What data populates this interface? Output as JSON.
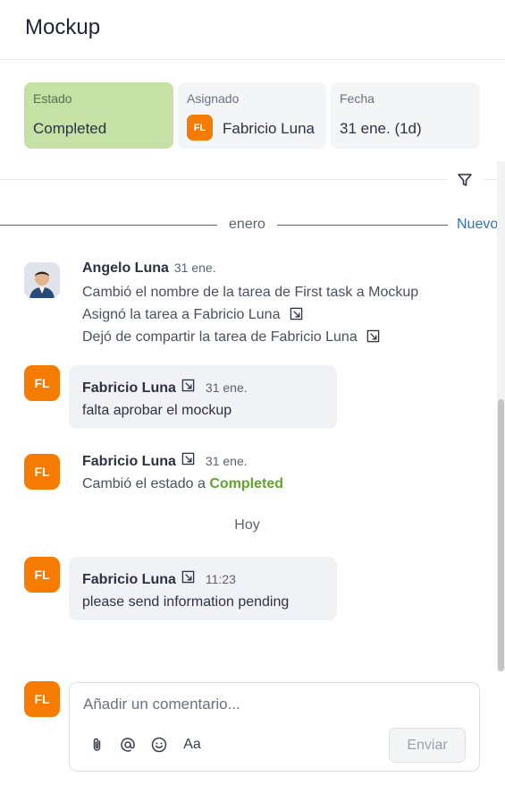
{
  "header": {
    "title": "Mockup"
  },
  "fields": {
    "status": {
      "label": "Estado",
      "value": "Completed"
    },
    "assignee": {
      "label": "Asignado",
      "initials": "FL",
      "value": "Fabricio Luna"
    },
    "date": {
      "label": "Fecha",
      "value": "31 ene. (1d)"
    }
  },
  "separator": {
    "month": "enero",
    "new_label": "Nuevo"
  },
  "feed": [
    {
      "author": "Angelo Luna",
      "time": "31 ene.",
      "lines": [
        "Cambió el nombre de la tarea de First task a Mockup",
        "Asignó la tarea a Fabricio Luna",
        "Dejó de compartir la tarea de Fabricio Luna"
      ]
    },
    {
      "author": "Fabricio Luna",
      "initials": "FL",
      "time": "31 ene.",
      "message": "falta aprobar el mockup"
    },
    {
      "author": "Fabricio Luna",
      "initials": "FL",
      "time": "31 ene.",
      "prefix": "Cambió el estado a",
      "status": "Completed"
    },
    {
      "author": "Fabricio Luna",
      "initials": "FL",
      "time": "11:23",
      "message": "please send information pending"
    }
  ],
  "day_label": "Hoy",
  "composer": {
    "initials": "FL",
    "placeholder": "Añadir un comentario...",
    "format_label": "Aa",
    "send_label": "Enviar"
  },
  "colors": {
    "status_completed_bg": "#c5e1a5",
    "status_completed_text": "#5fa52e",
    "avatar_orange": "#f57c00",
    "accent_blue": "#2f72b8"
  },
  "icons": [
    "filter-icon",
    "external-link-icon",
    "attachment-icon",
    "mention-icon",
    "emoji-icon"
  ]
}
